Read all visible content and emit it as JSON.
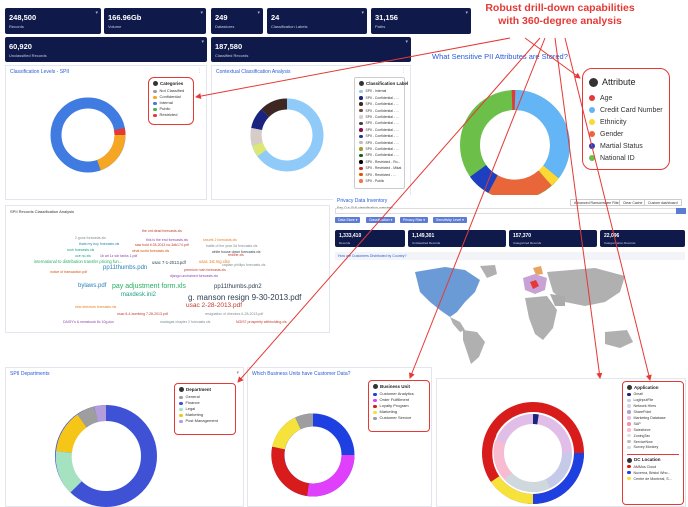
{
  "headline": {
    "line1": "Robust drill-down capabilities",
    "line2": "with 360-degree analysis"
  },
  "kpis": [
    {
      "value": "248,500",
      "label": "Records"
    },
    {
      "value": "166.96Gb",
      "label": "Volume"
    },
    {
      "value": "249",
      "label": "Datastores"
    },
    {
      "value": "24",
      "label": "Classification Labels"
    },
    {
      "value": "31,156",
      "label": "Paths"
    },
    {
      "value": "60,920",
      "label": "Unclassified Records"
    },
    {
      "value": "187,580",
      "label": "Classified Records"
    }
  ],
  "classification_panel": {
    "title": "Classification Levels - SPII",
    "legend_title": "Categories",
    "legend": [
      {
        "label": "Not Classified",
        "color": "#9e9e9e"
      },
      {
        "label": "Confidential",
        "color": "#f5a623"
      },
      {
        "label": "Internal",
        "color": "#3f7be0"
      },
      {
        "label": "Public",
        "color": "#4caf50"
      },
      {
        "label": "Restricted",
        "color": "#e53935"
      }
    ]
  },
  "contextual_panel": {
    "title": "Contextual Classification Analysis",
    "legend_title": "Classification Label",
    "legend": [
      {
        "label": "SPII - Internal",
        "color": "#90caf9"
      },
      {
        "label": "SPII - Confidential - ...",
        "color": "#1a237e"
      },
      {
        "label": "SPII - Confidential - ...",
        "color": "#3e2723"
      },
      {
        "label": "SPII - Confidential - ...",
        "color": "#6d4c41"
      },
      {
        "label": "SPII - Confidential - ...",
        "color": "#d7ccc8"
      },
      {
        "label": "SPII - Confidential - ...",
        "color": "#424242"
      },
      {
        "label": "SPII - Confidential - ...",
        "color": "#880e4f"
      },
      {
        "label": "SPII - Confidential - ...",
        "color": "#283593"
      },
      {
        "label": "SPII - Confidential - ...",
        "color": "#bdbdbd"
      },
      {
        "label": "SPII - Confidential - ...",
        "color": "#9e9d24"
      },
      {
        "label": "SPII - Confidential - ...",
        "color": "#1b5e20"
      },
      {
        "label": "SPII - Restricted - Ro...",
        "color": "#000000"
      },
      {
        "label": "SPII - Restricted - Mikat",
        "color": "#c62828"
      },
      {
        "label": "SPII - Restricted - ...",
        "color": "#e65100"
      },
      {
        "label": "SPII - Public",
        "color": "#ff7043"
      }
    ]
  },
  "pii_panel": {
    "title": "What Sensitive PII Attributes are Stored?",
    "legend_title": "Attribute",
    "legend": [
      {
        "label": "Age",
        "color": "#e53935"
      },
      {
        "label": "Credit Card Number",
        "color": "#64b5f6"
      },
      {
        "label": "Ethnicity",
        "color": "#fdd835"
      },
      {
        "label": "Gender",
        "color": "#e8663a"
      },
      {
        "label": "Martial Status",
        "color": "#1e3fbf"
      },
      {
        "label": "National ID",
        "color": "#6cc04a"
      }
    ]
  },
  "wordcloud": {
    "title": "SPII Records Classification Analysis",
    "words": [
      {
        "text": "the ont dead forecasts.xls",
        "color": "#c0392b",
        "size": 3.5
      },
      {
        "text": "2 guns forecasts.xls",
        "color": "#7f8c8d",
        "size": 3.5
      },
      {
        "text": "this is the end forecasts.xls",
        "color": "#8e44ad",
        "size": 3.5
      },
      {
        "text": "smurfs 2 forecasts.xls",
        "color": "#e67e22",
        "size": 3.5
      },
      {
        "text": "thats my boy forecasts.xls",
        "color": "#2980b9",
        "size": 3.5
      },
      {
        "text": "saw hold it 28-2013 no-3dk174.pdf",
        "color": "#c0392b",
        "size": 3.5
      },
      {
        "text": "battle of the year 3d forecasts.xls",
        "color": "#7f8c8d",
        "size": 3.5
      },
      {
        "text": "rush forecasts.xls",
        "color": "#16a085",
        "size": 3.5
      },
      {
        "text": "what world forecasts.xls",
        "color": "#d35400",
        "size": 3.5
      },
      {
        "text": "white house down forecasts.xls",
        "color": "#2c3e50",
        "size": 3.5
      },
      {
        "text": "oce no.xls",
        "color": "#16a085",
        "size": 3.5
      },
      {
        "text": "1b arl 1z sdr tanks 1.pdf",
        "color": "#8e44ad",
        "size": 3.5
      },
      {
        "text": "redlihe.xls",
        "color": "#c0392b",
        "size": 3.5
      },
      {
        "text": "international to distribution transfer pricing fun...",
        "color": "#27ae60",
        "size": 4.2
      },
      {
        "text": "usac 7-1-2013.pdf",
        "color": "#2c3e50",
        "size": 4.2
      },
      {
        "text": "usac 1st.mg.xlsx",
        "color": "#e67e22",
        "size": 4.2
      },
      {
        "text": "captain phillips forecasts.xls",
        "color": "#7f8c8d",
        "size": 3.5
      },
      {
        "text": "pp11thumbs.pdn",
        "color": "#2980b9",
        "size": 6
      },
      {
        "text": "premium rush forecasts.xls",
        "color": "#c0392b",
        "size": 3.5
      },
      {
        "text": "notice of transaction.pdf",
        "color": "#d35400",
        "size": 3.5
      },
      {
        "text": "django unchained forecasts.xls",
        "color": "#8e44ad",
        "size": 3.5
      },
      {
        "text": "pay adjustment form.xls",
        "color": "#27ae60",
        "size": 7
      },
      {
        "text": "pp11thumbs.pdn2",
        "color": "#2c3e50",
        "size": 6
      },
      {
        "text": "bylaws.pdf",
        "color": "#2980b9",
        "size": 6
      },
      {
        "text": "maxdesk.ini2",
        "color": "#16a085",
        "size": 6
      },
      {
        "text": "g. manson resign 9-30-2013.pdf",
        "color": "#2c3e50",
        "size": 8
      },
      {
        "text": "usac 2-28-2013.pdf",
        "color": "#c0392b",
        "size": 6.5
      },
      {
        "text": "resignation of directors 6-28-2013.pdf",
        "color": "#7f8c8d",
        "size": 3.5
      },
      {
        "text": "usac 6-4-bombing 7-28-2013.pdf",
        "color": "#c0392b",
        "size": 3.5
      },
      {
        "text": "new directors forecasts.xls",
        "color": "#e67e22",
        "size": 3.5
      },
      {
        "text": "DAISY's & newsbook 8c 10g.doc",
        "color": "#8e44ad",
        "size": 3.5
      },
      {
        "text": "madagas chapter 2 forecasts.xls",
        "color": "#7f8c8d",
        "size": 3.5
      },
      {
        "text": "NOIS7 prosperity withholding.xls",
        "color": "#c0392b",
        "size": 3.5
      }
    ]
  },
  "privacy": {
    "title": "Privacy Data Inventory",
    "subtitle": "Key Cut: Full classification overview",
    "buttons": [
      "Advanced Ransomware Filter",
      "Clear Cache",
      "Custom dashboard"
    ],
    "filters": [
      "Data Store",
      "Classification",
      "Privacy Risk",
      "Sensitivity Level"
    ],
    "stats": [
      {
        "value": "1,333,410",
        "label": "Records"
      },
      {
        "value": "1,149,301",
        "label": "Unclassified Records"
      },
      {
        "value": "157,370",
        "label": "Categorized Records"
      },
      {
        "value": "22,096",
        "label": "Categorization Records"
      }
    ],
    "map_title": "How are Customers Distributed by Country?"
  },
  "departments": {
    "title": "SPII Departments",
    "legend_title": "Department",
    "legend": [
      {
        "label": "General",
        "color": "#9e9e9e"
      },
      {
        "label": "Finance",
        "color": "#3f51d5"
      },
      {
        "label": "Legal",
        "color": "#a5e3c0"
      },
      {
        "label": "Marketing",
        "color": "#f5c518"
      },
      {
        "label": "Post Management",
        "color": "#b39ddb"
      }
    ]
  },
  "business_units": {
    "title": "Which Business Units have Customer Data?",
    "legend_title": "Business Unit",
    "legend": [
      {
        "label": "Customer Analytics",
        "color": "#1e40e0"
      },
      {
        "label": "Order Fulfillment",
        "color": "#e040fb"
      },
      {
        "label": "Loyalty Program",
        "color": "#d81b1b"
      },
      {
        "label": "Marketing",
        "color": "#f5e23a"
      },
      {
        "label": "Customer Service",
        "color": "#9e9e9e"
      }
    ]
  },
  "applications": {
    "legend_title": "Application",
    "legend": [
      {
        "label": "Gmail",
        "color": "#1a237e"
      },
      {
        "label": "LogInputFile",
        "color": "#c5cae9"
      },
      {
        "label": "Network Hiers",
        "color": "#cfd8dc"
      },
      {
        "label": "SharePoint",
        "color": "#b39ddb"
      },
      {
        "label": "Marketing Database",
        "color": "#e1bee7"
      },
      {
        "label": "SAP",
        "color": "#f48fb1"
      },
      {
        "label": "Salesforce",
        "color": "#f8bbd0"
      },
      {
        "label": "ZoningTax",
        "color": "#e0e0e0"
      },
      {
        "label": "ServiceNow",
        "color": "#bdbdbd"
      },
      {
        "label": "Survey Monkey",
        "color": "#cfd8dc"
      }
    ],
    "location_title": "DC Location",
    "locations": [
      {
        "label": "AMMus Cloud",
        "color": "#d81b1b"
      },
      {
        "label": "Nuverna, Bristol Who...",
        "color": "#1e40e0"
      },
      {
        "label": "Centre de Montreal, S...",
        "color": "#f5e23a"
      }
    ]
  },
  "colors": {
    "navy": "#101a4a",
    "accent_red": "#e53935",
    "link_blue": "#2a5bd7"
  }
}
